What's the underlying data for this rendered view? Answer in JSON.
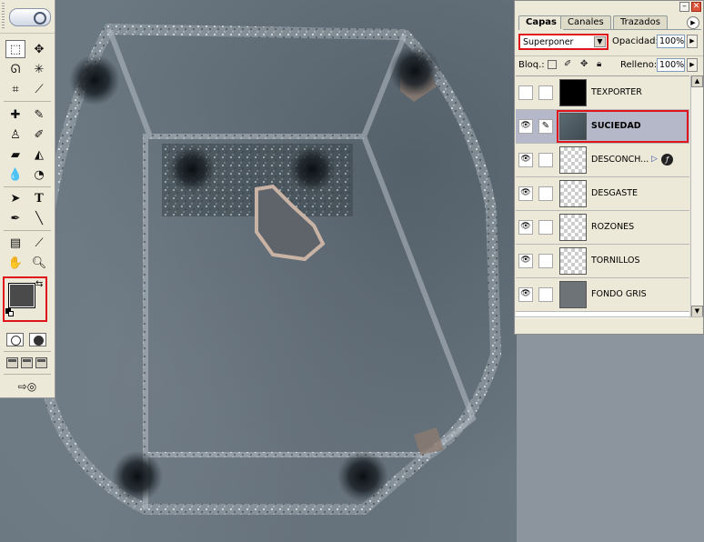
{
  "tabs": [
    {
      "label": "Capas",
      "active": true
    },
    {
      "label": "Canales",
      "active": false
    },
    {
      "label": "Trazados",
      "active": false
    }
  ],
  "blend_mode": "Superponer",
  "opacity_label": "Opacidad:",
  "opacity_value": "100%",
  "lock_label": "Bloq.:",
  "fill_label": "Relleno:",
  "fill_value": "100%",
  "layers": [
    {
      "name": "TEXPORTER",
      "visible": false,
      "thumb": "black",
      "selected": false
    },
    {
      "name": "SUCIEDAD",
      "visible": true,
      "thumb": "dirt",
      "selected": true
    },
    {
      "name": "DESCONCH...",
      "visible": true,
      "thumb": "check",
      "selected": false,
      "has_effects": true
    },
    {
      "name": "DESGASTE",
      "visible": true,
      "thumb": "check",
      "selected": false
    },
    {
      "name": "ROZONES",
      "visible": true,
      "thumb": "check",
      "selected": false
    },
    {
      "name": "TORNILLOS",
      "visible": true,
      "thumb": "check",
      "selected": false
    },
    {
      "name": "FONDO GRIS",
      "visible": true,
      "thumb": "gray",
      "selected": false
    }
  ],
  "foreground_color": "#4a4a4a",
  "background_color": "#6a6a6a",
  "highlight_color": "#e0141b",
  "tools": [
    "marquee-icon",
    "move-icon",
    "lasso-icon",
    "magic-wand-icon",
    "crop-icon",
    "slice-icon",
    "healing-icon",
    "brush-icon",
    "stamp-icon",
    "history-brush-icon",
    "eraser-icon",
    "bucket-icon",
    "blur-icon",
    "dodge-icon",
    "path-select-icon",
    "type-icon",
    "pen-icon",
    "line-icon",
    "notes-icon",
    "eyedropper-icon",
    "hand-icon",
    "zoom-icon"
  ],
  "close_glyph": "✕",
  "minimize_glyph": "–",
  "dropdown_glyph": "▼",
  "spin_glyph": "▶",
  "eye_glyph": "👁",
  "brush_glyph": "✎",
  "fx_glyph": "ƒ",
  "fx_arrow_glyph": "▷",
  "menu_glyph": "▶",
  "swap_glyph": "⇆",
  "scroll_up_glyph": "▲",
  "scroll_down_glyph": "▼"
}
